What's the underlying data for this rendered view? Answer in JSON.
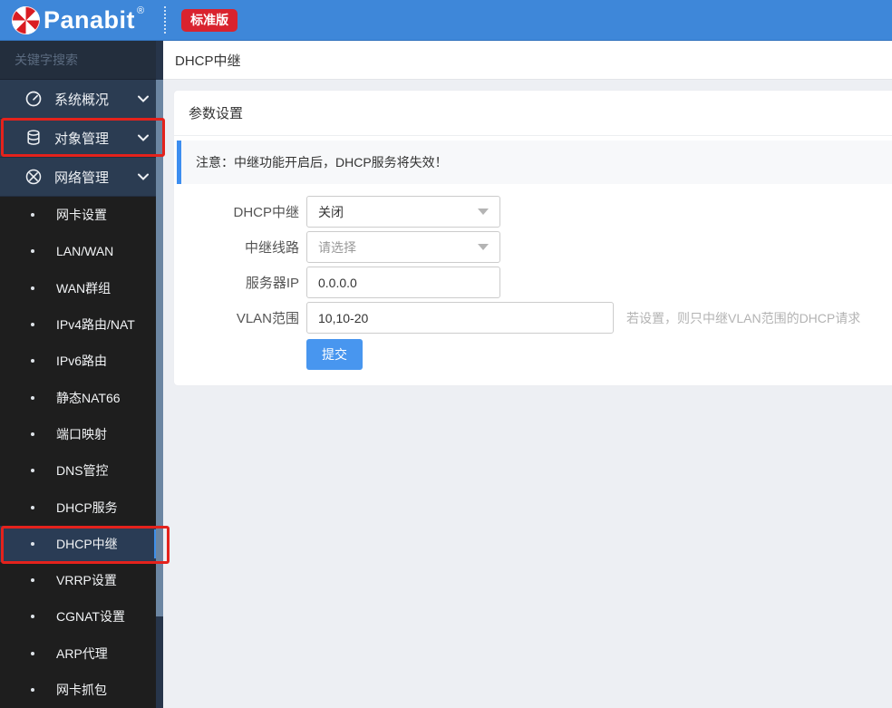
{
  "topbar": {
    "brand": "Panabit",
    "reg": "®",
    "badge": "标准版"
  },
  "sidebar": {
    "search_placeholder": "关键字搜索",
    "sections": [
      {
        "label": "系统概况",
        "icon": "gauge-icon"
      },
      {
        "label": "对象管理",
        "icon": "database-icon"
      },
      {
        "label": "网络管理",
        "icon": "network-icon"
      }
    ],
    "submenu": [
      "网卡设置",
      "LAN/WAN",
      "WAN群组",
      "IPv4路由/NAT",
      "IPv6路由",
      "静态NAT66",
      "端口映射",
      "DNS管控",
      "DHCP服务",
      "DHCP中继",
      "VRRP设置",
      "CGNAT设置",
      "ARP代理",
      "网卡抓包"
    ],
    "active_item": "DHCP中继"
  },
  "main": {
    "page_title": "DHCP中继",
    "panel_title": "参数设置",
    "notice": "注意：中继功能开启后，DHCP服务将失效！",
    "form": {
      "rows": [
        {
          "label": "DHCP中继",
          "type": "select",
          "value": "关闭"
        },
        {
          "label": "中继线路",
          "type": "select",
          "value": "请选择"
        },
        {
          "label": "服务器IP",
          "type": "input",
          "value": "0.0.0.0"
        },
        {
          "label": "VLAN范围",
          "type": "input",
          "value": "10,10-20",
          "hint": "若设置，则只中继VLAN范围的DHCP请求"
        }
      ],
      "submit_label": "提交"
    }
  },
  "colors": {
    "topbar_blue": "#3e87d9",
    "badge_red": "#d9232e",
    "accent_blue": "#3d8ef0",
    "annotation_red": "#e4221c",
    "sidebar_dark": "#1e1e1e",
    "sidebar_navy": "#2b3c52"
  }
}
